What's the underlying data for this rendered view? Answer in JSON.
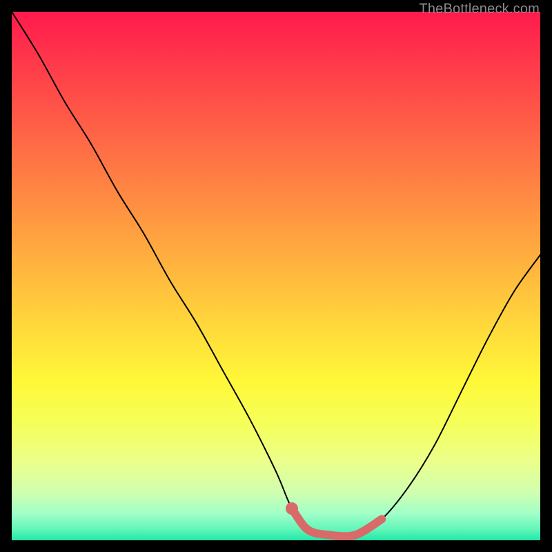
{
  "watermark": "TheBottleneck.com",
  "chart_data": {
    "type": "line",
    "title": "",
    "xlabel": "",
    "ylabel": "",
    "xlim": [
      0,
      100
    ],
    "ylim": [
      0,
      100
    ],
    "grid": false,
    "legend": false,
    "series": [
      {
        "name": "black-curve",
        "color": "#000000",
        "stroke_width": 2,
        "x": [
          0,
          5,
          10,
          15,
          20,
          25,
          30,
          35,
          40,
          45,
          50,
          53,
          56,
          60,
          65,
          70,
          75,
          80,
          85,
          90,
          95,
          100
        ],
        "y": [
          100,
          92,
          83,
          75,
          66,
          58,
          49,
          41,
          32,
          23,
          13,
          6,
          2,
          1,
          1,
          4,
          10,
          18,
          28,
          38,
          47,
          54
        ]
      },
      {
        "name": "red-overlay",
        "color": "#d86a6a",
        "stroke_width": 12,
        "linecap": "round",
        "x": [
          53,
          56,
          60,
          65,
          70
        ],
        "y": [
          6,
          2,
          1,
          1,
          4
        ]
      }
    ],
    "extra_markers": [
      {
        "name": "red-dot",
        "x": 53,
        "y": 6,
        "r": 9,
        "color": "#d86a6a"
      }
    ]
  }
}
